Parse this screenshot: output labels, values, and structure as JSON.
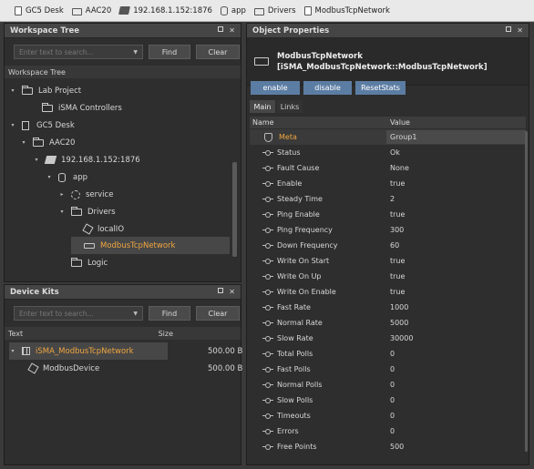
{
  "breadcrumb": [
    "GC5 Desk",
    "AAC20",
    "192.168.1.152:1876",
    "app",
    "Drivers",
    "ModbusTcpNetwork"
  ],
  "workspace": {
    "title": "Workspace Tree",
    "search_placeholder": "Enter text to search...",
    "find_label": "Find",
    "clear_label": "Clear",
    "subheader": "Workspace Tree",
    "nodes": [
      "Lab Project",
      "iSMA Controllers",
      "GC5 Desk",
      "AAC20",
      "192.168.1.152:1876",
      "app",
      "service",
      "Drivers",
      "localIO",
      "ModbusTcpNetwork",
      "Logic"
    ]
  },
  "device_kits": {
    "title": "Device Kits",
    "search_placeholder": "Enter text to search...",
    "find_label": "Find",
    "clear_label": "Clear",
    "col_text": "Text",
    "col_size": "Size",
    "rows": [
      {
        "name": "iSMA_ModbusTcpNetwork",
        "size": "500.00 B"
      },
      {
        "name": "ModbusDevice",
        "size": "500.00 B"
      }
    ]
  },
  "object": {
    "panel_title": "Object Properties",
    "name": "ModbusTcpNetwork",
    "type": "[iSMA_ModbusTcpNetwork::ModbusTcpNetwork]",
    "actions": [
      "enable",
      "disable",
      "ResetStats"
    ],
    "tabs": [
      "Main",
      "Links"
    ],
    "col_name": "Name",
    "col_value": "Value",
    "props": [
      {
        "name": "Meta",
        "value": "Group1"
      },
      {
        "name": "Status",
        "value": "Ok"
      },
      {
        "name": "Fault Cause",
        "value": "None"
      },
      {
        "name": "Enable",
        "value": "true"
      },
      {
        "name": "Steady Time",
        "value": "2"
      },
      {
        "name": "Ping Enable",
        "value": "true"
      },
      {
        "name": "Ping Frequency",
        "value": "300"
      },
      {
        "name": "Down Frequency",
        "value": "60"
      },
      {
        "name": "Write On Start",
        "value": "true"
      },
      {
        "name": "Write On Up",
        "value": "true"
      },
      {
        "name": "Write On Enable",
        "value": "true"
      },
      {
        "name": "Fast Rate",
        "value": "1000"
      },
      {
        "name": "Normal Rate",
        "value": "5000"
      },
      {
        "name": "Slow Rate",
        "value": "30000"
      },
      {
        "name": "Total Polls",
        "value": "0"
      },
      {
        "name": "Fast Polls",
        "value": "0"
      },
      {
        "name": "Normal Polls",
        "value": "0"
      },
      {
        "name": "Slow Polls",
        "value": "0"
      },
      {
        "name": "Timeouts",
        "value": "0"
      },
      {
        "name": "Errors",
        "value": "0"
      },
      {
        "name": "Free Points",
        "value": "500"
      }
    ]
  },
  "colors": {
    "accent_orange": "#f0a640",
    "action_blue": "#5c7da3"
  }
}
